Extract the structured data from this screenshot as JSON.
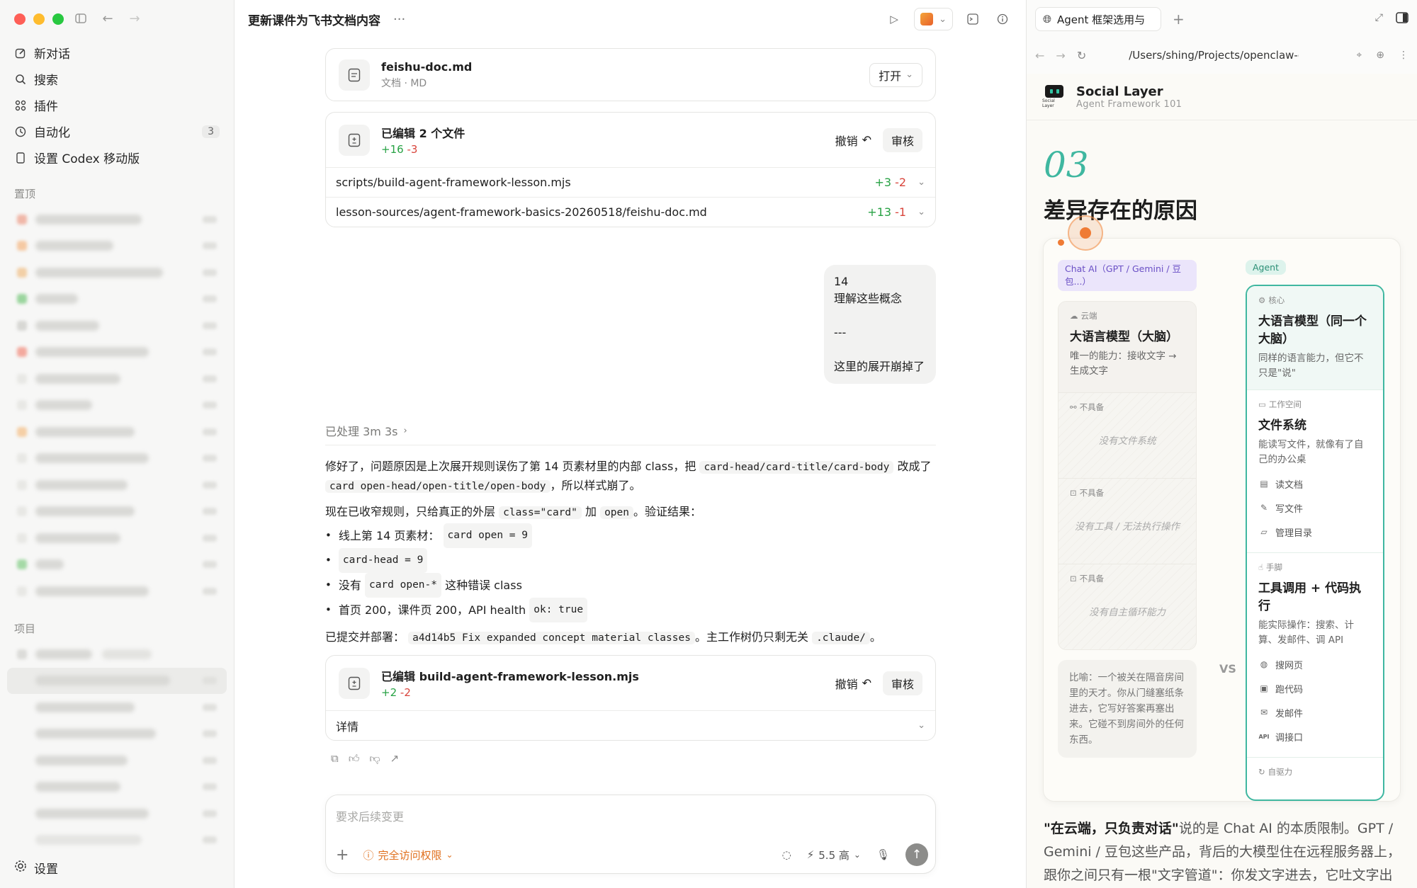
{
  "sidebar": {
    "nav": [
      {
        "label": "新对话",
        "icon": "edit-icon"
      },
      {
        "label": "搜索",
        "icon": "search-icon"
      },
      {
        "label": "插件",
        "icon": "plugins-icon"
      },
      {
        "label": "自动化",
        "icon": "clock-icon",
        "badge": "3"
      },
      {
        "label": "设置 Codex 移动版",
        "icon": "phone-icon"
      }
    ],
    "pinned_label": "置顶",
    "projects_label": "项目",
    "settings_label": "设置"
  },
  "main": {
    "title": "更新课件为飞书文档内容",
    "file_card": {
      "name": "feishu-doc.md",
      "meta": "文档 · MD",
      "open_label": "打开"
    },
    "edit_card": {
      "title": "已编辑 2 个文件",
      "add": "+16",
      "del": "-3",
      "undo_label": "撤销",
      "review_label": "审核",
      "files": [
        {
          "path": "scripts/build-agent-framework-lesson.mjs",
          "add": "+3",
          "del": "-2"
        },
        {
          "path": "lesson-sources/agent-framework-basics-20260518/feishu-doc.md",
          "add": "+13",
          "del": "-1"
        }
      ]
    },
    "user_message": "14\n理解这些概念\n\n---\n\n这里的展开崩掉了",
    "processed": "已处理 3m 3s",
    "answer": {
      "p1_a": "修好了，问题原因是上次展开规则误伤了第 14 页素材里的内部 class，把",
      "p1_code1": "card-head/card-title/card-body",
      "p1_b": "改成了",
      "p1_code2": "card open-head/open-title/open-body",
      "p1_c": "，所以样式崩了。",
      "p2_a": "现在已收窄规则，只给真正的外层",
      "p2_code1": "class=\"card\"",
      "p2_b": "加",
      "p2_code2": "open",
      "p2_c": "。验证结果：",
      "bullet1_a": "线上第 14 页素材：",
      "bullet1_code": "card open = 9",
      "bullet2_code": "card-head = 9",
      "bullet3_a": "没有",
      "bullet3_code": "card open-*",
      "bullet3_b": "这种错误 class",
      "bullet4_a": "首页 200，课件页 200，API health",
      "bullet4_code": "ok: true",
      "p3_a": "已提交并部署：",
      "p3_code1": "a4d14b5 Fix expanded concept material classes",
      "p3_b": "。主工作树仍只剩无关",
      "p3_code2": ".claude/",
      "p3_c": "。"
    },
    "edit_card2": {
      "title": "已编辑 build-agent-framework-lesson.mjs",
      "add": "+2",
      "del": "-2",
      "undo_label": "撤销",
      "review_label": "审核",
      "details_label": "详情"
    },
    "composer": {
      "placeholder": "要求后续变更",
      "access_label": "完全访问权限",
      "model_label": "5.5 高"
    }
  },
  "browser": {
    "tab_title": "Agent 框架选用与",
    "url": "/Users/shing/Projects/openclaw-c",
    "site": {
      "name": "Social Layer",
      "subtitle": "Agent Framework 101",
      "logo_caption": "Social Layer",
      "chapter_no": "03",
      "chapter_title": "差异存在的原因",
      "left_pill": "Chat AI（GPT / Gemini / 豆包...）",
      "right_pill": "Agent",
      "left": {
        "cloud_tag": "云端",
        "llm_title": "大语言模型（大脑）",
        "llm_desc": "唯一的能力：接收文字 → 生成文字",
        "na_tag": "不具备",
        "na1": "没有文件系统",
        "na2": "没有工具 / 无法执行操作",
        "na3": "没有自主循环能力",
        "analogy": "比喻：一个被关在隔音房间里的天才。你从门缝塞纸条进去，它写好答案再塞出来。它碰不到房间外的任何东西。"
      },
      "vs": "VS",
      "right": {
        "core_tag": "核心",
        "core_title": "大语言模型（同一个大脑）",
        "core_desc": "同样的语言能力，但它不只是\"说\"",
        "ws_tag": "工作空间",
        "ws_title": "文件系统",
        "ws_desc": "能读写文件，就像有了自己的办公桌",
        "ws_items": [
          "读文档",
          "写文件",
          "管理目录"
        ],
        "hands_tag": "手脚",
        "hands_title": "工具调用 + 代码执行",
        "hands_desc": "能实际操作：搜索、计算、发邮件、调 API",
        "hands_items": [
          "搜网页",
          "跑代码",
          "发邮件",
          "调接口"
        ],
        "auto_tag": "自驱力"
      },
      "article_bold": "\"在云端，只负责对话\"",
      "article_rest": "说的是 Chat AI 的本质限制。GPT / Gemini / 豆包这些产品，背后的大模型住在远程服务器上，跟你之间只有一根\"文字管道\"：你发文字进去，它吐文字出"
    }
  }
}
